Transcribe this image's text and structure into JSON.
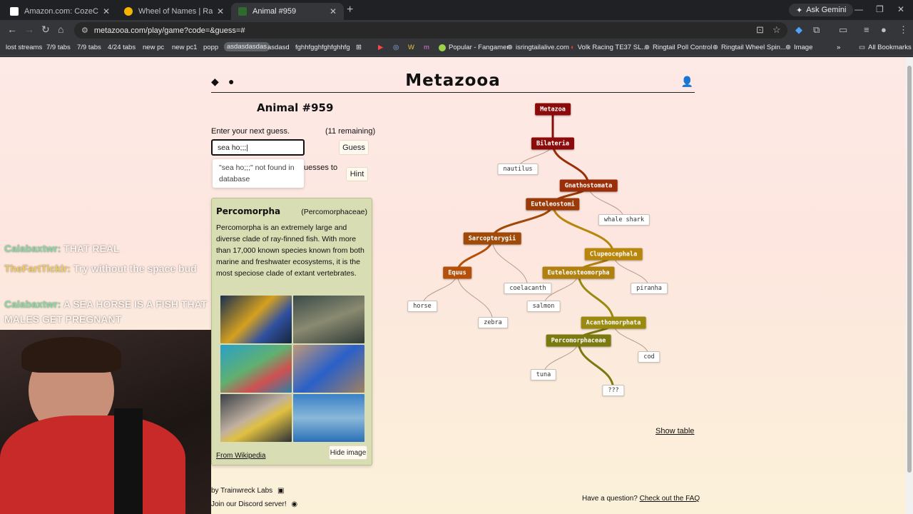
{
  "browser": {
    "tabs": [
      {
        "title": "Amazon.com: CozeCube Super",
        "favicon_color": "#ffffff",
        "active": false
      },
      {
        "title": "Wheel of Names | Random name",
        "favicon_color": "#f4b400",
        "active": false
      },
      {
        "title": "Animal #959",
        "favicon_color": "#2f6b2f",
        "active": true
      }
    ],
    "new_tab": "+",
    "ask_gemini": "Ask Gemini",
    "url": "metazooa.com/play/game?code=&guess=#",
    "bookmarks": [
      "lost streams",
      "7/9 tabs",
      "7/9 tabs",
      "4/24 tabs",
      "new pc",
      "new pc1",
      "popp",
      "asdasdasdas",
      "asdasd",
      "fghhfgghfghfghhfg",
      "Popular - Fangamer",
      "isringtailalive.com",
      "Volk Racing TE37 SL...",
      "Ringtail Poll Control",
      "Ringtail Wheel Spin...",
      "Image",
      "All Bookmarks"
    ]
  },
  "site": {
    "logo": "Metazooa",
    "animal_title": "Animal #959",
    "prompt": "Enter your next guess.",
    "remaining": "(11 remaining)",
    "input_value": "sea ho;;;|",
    "guess_button": "Guess",
    "hint_text": "uesses to",
    "hint_button": "Hint",
    "dropdown_message": "\"sea ho;;;\" not found in database",
    "show_table": "Show table",
    "footer_left_1": "by Trainwreck Labs",
    "footer_left_2": "Join our Discord server!",
    "footer_right_prefix": "Have a question?",
    "footer_right_link": "Check out the FAQ"
  },
  "info_card": {
    "name": "Percomorpha",
    "family": "(Percomorphaceae)",
    "description": "Percomorpha is an extremely large and diverse clade of ray-finned fish. With more than 17,000 known species known from both marine and freshwater ecosystems, it is the most speciose clade of extant vertebrates.",
    "image_colors": [
      "#2c4a73",
      "#5a6b5a",
      "#2d8fb5",
      "#3a6aa8",
      "#556070",
      "#4a8ccc"
    ],
    "wiki_link": "From Wikipedia",
    "hide_image": "Hide image"
  },
  "tree": {
    "nodes": [
      {
        "id": "metazoa",
        "label": "Metazoa",
        "kind": "clade",
        "color": "#8b0a0a"
      },
      {
        "id": "bilateria",
        "label": "Bilateria",
        "kind": "clade",
        "color": "#8b0a0a"
      },
      {
        "id": "nautilus",
        "label": "nautilus",
        "kind": "leaf"
      },
      {
        "id": "gnathostomata",
        "label": "Gnathostomata",
        "kind": "clade",
        "color": "#9a2e08"
      },
      {
        "id": "whale_shark",
        "label": "whale shark",
        "kind": "leaf"
      },
      {
        "id": "euteleostomi",
        "label": "Euteleostomi",
        "kind": "clade",
        "color": "#9a3a08"
      },
      {
        "id": "sarcopterygii",
        "label": "Sarcopterygii",
        "kind": "clade",
        "color": "#a04a0a"
      },
      {
        "id": "clupeocephala",
        "label": "Clupeocephala",
        "kind": "clade",
        "color": "#b8860b"
      },
      {
        "id": "equus",
        "label": "Equus",
        "kind": "clade",
        "color": "#b5500a"
      },
      {
        "id": "coelacanth",
        "label": "coelacanth",
        "kind": "leaf"
      },
      {
        "id": "euteleosteomorpha",
        "label": "Euteleosteomorpha",
        "kind": "clade",
        "color": "#b08010"
      },
      {
        "id": "piranha",
        "label": "piranha",
        "kind": "leaf"
      },
      {
        "id": "horse",
        "label": "horse",
        "kind": "leaf"
      },
      {
        "id": "zebra",
        "label": "zebra",
        "kind": "leaf"
      },
      {
        "id": "salmon",
        "label": "salmon",
        "kind": "leaf"
      },
      {
        "id": "acanthomorphata",
        "label": "Acanthomorphata",
        "kind": "clade",
        "color": "#9a8a10"
      },
      {
        "id": "percomorphaceae",
        "label": "Percomorphaceae",
        "kind": "clade",
        "color": "#7a7a10"
      },
      {
        "id": "cod",
        "label": "cod",
        "kind": "leaf"
      },
      {
        "id": "tuna",
        "label": "tuna",
        "kind": "leaf"
      },
      {
        "id": "unknown",
        "label": "???",
        "kind": "leaf"
      }
    ],
    "edges": [
      [
        "metazoa",
        "bilateria"
      ],
      [
        "bilateria",
        "nautilus"
      ],
      [
        "bilateria",
        "gnathostomata"
      ],
      [
        "gnathostomata",
        "whale_shark"
      ],
      [
        "gnathostomata",
        "euteleostomi"
      ],
      [
        "euteleostomi",
        "sarcopterygii"
      ],
      [
        "euteleostomi",
        "clupeocephala"
      ],
      [
        "sarcopterygii",
        "equus"
      ],
      [
        "sarcopterygii",
        "coelacanth"
      ],
      [
        "equus",
        "horse"
      ],
      [
        "equus",
        "zebra"
      ],
      [
        "clupeocephala",
        "euteleosteomorpha"
      ],
      [
        "clupeocephala",
        "piranha"
      ],
      [
        "euteleosteomorpha",
        "salmon"
      ],
      [
        "euteleosteomorpha",
        "acanthomorphata"
      ],
      [
        "acanthomorphata",
        "percomorphaceae"
      ],
      [
        "acanthomorphata",
        "cod"
      ],
      [
        "percomorphaceae",
        "tuna"
      ],
      [
        "percomorphaceae",
        "unknown"
      ]
    ]
  },
  "stream_overlay": {
    "chat": [
      {
        "user": "Calabaxtwr:",
        "message": "THAT REAL"
      },
      {
        "user": "TheFartTicklr:",
        "message": "Try without the space bud"
      },
      {
        "user": "Calabaxtwr:",
        "message": "A SEA HORSE IS A FISH THAT MALES GET PREGNANT"
      }
    ]
  }
}
